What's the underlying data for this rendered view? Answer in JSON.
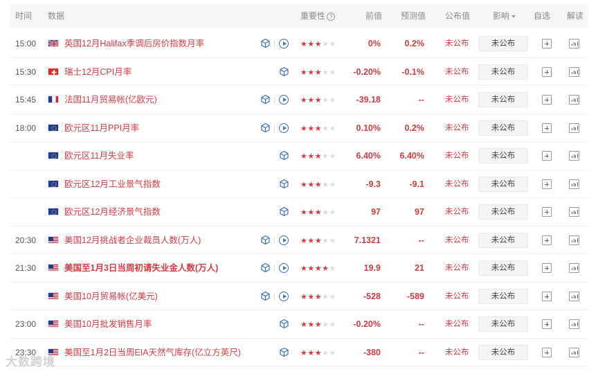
{
  "header": {
    "time": "时间",
    "data": "数据",
    "importance": "重要性",
    "importance_help": "?",
    "previous": "前值",
    "forecast": "预测值",
    "published": "公布值",
    "impact": "影响",
    "watchlist": "自选",
    "interpret": "解读"
  },
  "rows": [
    {
      "time": "15:00",
      "flag": "uk",
      "name": "英国12月Halifax季调后房价指数月率",
      "bold": false,
      "play": true,
      "stars": 3,
      "prev": "0%",
      "fcst": "0.2%",
      "pub": "未公布",
      "impact": "未公布"
    },
    {
      "time": "15:30",
      "flag": "ch",
      "name": "瑞士12月CPI月率",
      "bold": false,
      "play": false,
      "stars": 3,
      "prev": "-0.20%",
      "fcst": "-0.1%",
      "pub": "未公布",
      "impact": "未公布"
    },
    {
      "time": "15:45",
      "flag": "fr",
      "name": "法国11月贸易帐(亿欧元)",
      "bold": false,
      "play": true,
      "stars": 3,
      "prev": "-39.18",
      "fcst": "--",
      "pub": "未公布",
      "impact": "未公布"
    },
    {
      "time": "18:00",
      "flag": "eu",
      "name": "欧元区11月PPI月率",
      "bold": false,
      "play": true,
      "stars": 3,
      "prev": "0.10%",
      "fcst": "0.2%",
      "pub": "未公布",
      "impact": "未公布"
    },
    {
      "time": "",
      "flag": "eu",
      "name": "欧元区11月失业率",
      "bold": false,
      "play": false,
      "stars": 3,
      "prev": "6.40%",
      "fcst": "6.40%",
      "pub": "未公布",
      "impact": "未公布"
    },
    {
      "time": "",
      "flag": "eu",
      "name": "欧元区12月工业景气指数",
      "bold": false,
      "play": false,
      "stars": 3,
      "prev": "-9.3",
      "fcst": "-9.1",
      "pub": "未公布",
      "impact": "未公布"
    },
    {
      "time": "",
      "flag": "eu",
      "name": "欧元区12月经济景气指数",
      "bold": false,
      "play": false,
      "stars": 3,
      "prev": "97",
      "fcst": "97",
      "pub": "未公布",
      "impact": "未公布"
    },
    {
      "time": "20:30",
      "flag": "us",
      "name": "美国12月挑战者企业裁员人数(万人)",
      "bold": false,
      "play": true,
      "stars": 3,
      "prev": "7.1321",
      "fcst": "--",
      "pub": "未公布",
      "impact": "未公布"
    },
    {
      "time": "21:30",
      "flag": "us",
      "name": "美国至1月3日当周初请失业金人数(万人)",
      "bold": true,
      "play": true,
      "stars": 4,
      "prev": "19.9",
      "fcst": "21",
      "pub": "未公布",
      "impact": "未公布"
    },
    {
      "time": "",
      "flag": "us",
      "name": "美国10月贸易帐(亿美元)",
      "bold": false,
      "play": true,
      "stars": 3,
      "prev": "-528",
      "fcst": "-589",
      "pub": "未公布",
      "impact": "未公布"
    },
    {
      "time": "23:00",
      "flag": "us",
      "name": "美国10月批发销售月率",
      "bold": false,
      "play": false,
      "stars": 3,
      "prev": "-0.20%",
      "fcst": "--",
      "pub": "未公布",
      "impact": "未公布"
    },
    {
      "time": "23:30",
      "flag": "us",
      "name": "美国至1月2日当周EIA天然气库存(亿立方英尺)",
      "bold": false,
      "play": false,
      "stars": 3,
      "prev": "-380",
      "fcst": "--",
      "pub": "未公布",
      "impact": "未公布"
    }
  ],
  "max_stars": 5,
  "watermark": "大数跨境",
  "colors": {
    "accent": "#d23b45",
    "icon_blue": "#3d6fb8"
  }
}
